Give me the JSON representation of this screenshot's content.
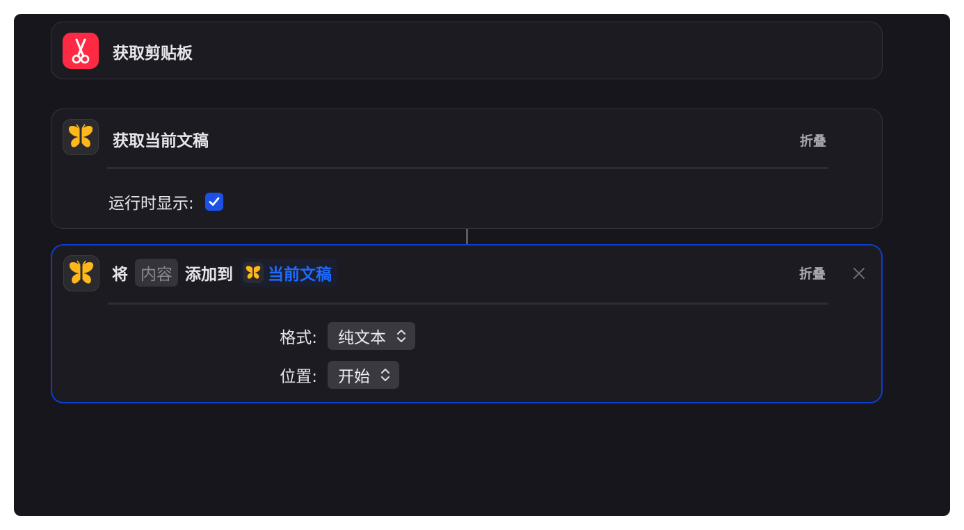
{
  "actions": [
    {
      "title": "获取剪贴板",
      "icon": "scissors-icon",
      "icon_color": "#fe2a43"
    },
    {
      "title": "获取当前文稿",
      "icon": "butterfly-icon",
      "fold_label": "折叠",
      "option_label": "运行时显示:",
      "option_checked": true
    },
    {
      "icon": "butterfly-icon",
      "word_1": "将",
      "placeholder": "内容",
      "word_2": "添加到",
      "variable": "当前文稿",
      "fold_label": "折叠",
      "close_icon": "close-icon",
      "params": [
        {
          "label": "格式:",
          "value": "纯文本"
        },
        {
          "label": "位置:",
          "value": "开始"
        }
      ]
    }
  ],
  "colors": {
    "background": "#18161d",
    "card": "#1d1b22",
    "selected_border": "#0b3fd1",
    "variable_text": "#1f6bff",
    "checkbox": "#1d51e6"
  }
}
